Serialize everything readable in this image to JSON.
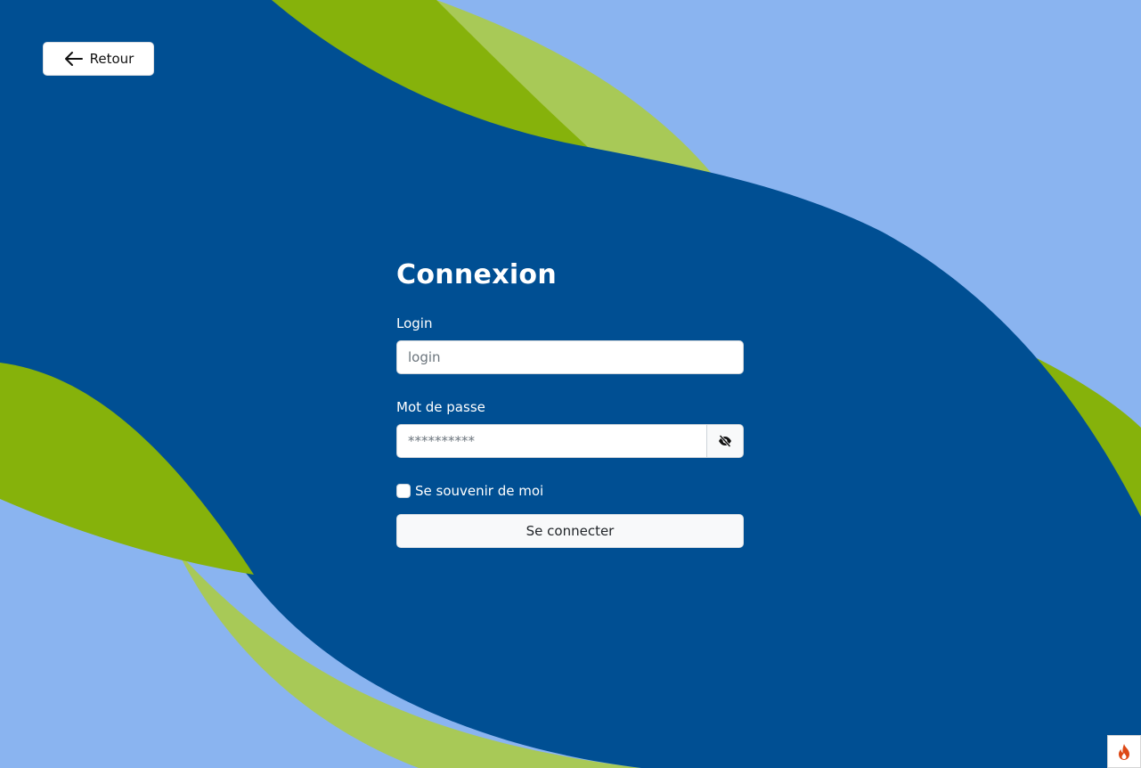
{
  "header": {
    "back_label": "Retour",
    "back_icon": "arrow-left-icon"
  },
  "form": {
    "title": "Connexion",
    "login_label": "Login",
    "login_placeholder": "login",
    "password_label": "Mot de passe",
    "password_placeholder": "**********",
    "password_toggle_icon": "eye-slash-icon",
    "remember_label": "Se souvenir de moi",
    "submit_label": "Se connecter"
  },
  "footer": {
    "debug_icon": "flame-icon"
  },
  "colors": {
    "primary_blue": "#004f93",
    "light_blue": "#8ab4f0",
    "green": "#86b20b",
    "light_green": "#a8c957"
  }
}
